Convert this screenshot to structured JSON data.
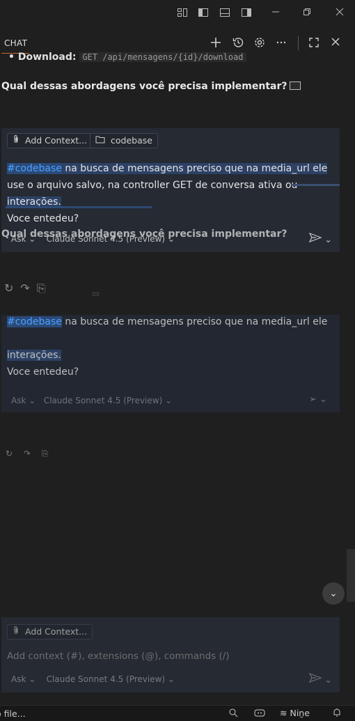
{
  "titlebar": {
    "icons": [
      "customize-layout-icon",
      "toggle-primary-sidebar-icon",
      "toggle-panel-icon",
      "toggle-secondary-sidebar-icon",
      "minimize-icon",
      "restore-icon",
      "close-icon"
    ]
  },
  "view": {
    "tab_label": "CHAT",
    "actions": [
      "new-chat-icon",
      "history-icon",
      "settings-icon",
      "more-icon",
      "maximize-icon",
      "close-icon"
    ]
  },
  "response": {
    "download_label": "Download:",
    "download_code": "GET /api/mensagens/{id}/download",
    "question": "Qual dessas abordagens você precisa implementar?"
  },
  "composer": {
    "add_context_label": "Add Context...",
    "codebase_chip": "codebase",
    "hashtag": "#codebase",
    "prompt_rest_line1": " na busca de mensagens preciso que na media_url ele",
    "prompt_line2": "use o arquivo salvo, na controller GET de conversa ativa ou",
    "prompt_line3": "interações.",
    "prompt_line4": "Voce entedeu?",
    "mode": "Ask",
    "model": "Claude Sonnet 4.5 (Preview)",
    "input_placeholder": "Add context (#), extensions (@), commands (/)"
  },
  "statusbar": {
    "left_text": "o file...",
    "right_label": "Niṉe"
  },
  "colors": {
    "accent_tab": "#cc6633",
    "hashtag": "#4d9fff",
    "selection": "#2d4165"
  }
}
